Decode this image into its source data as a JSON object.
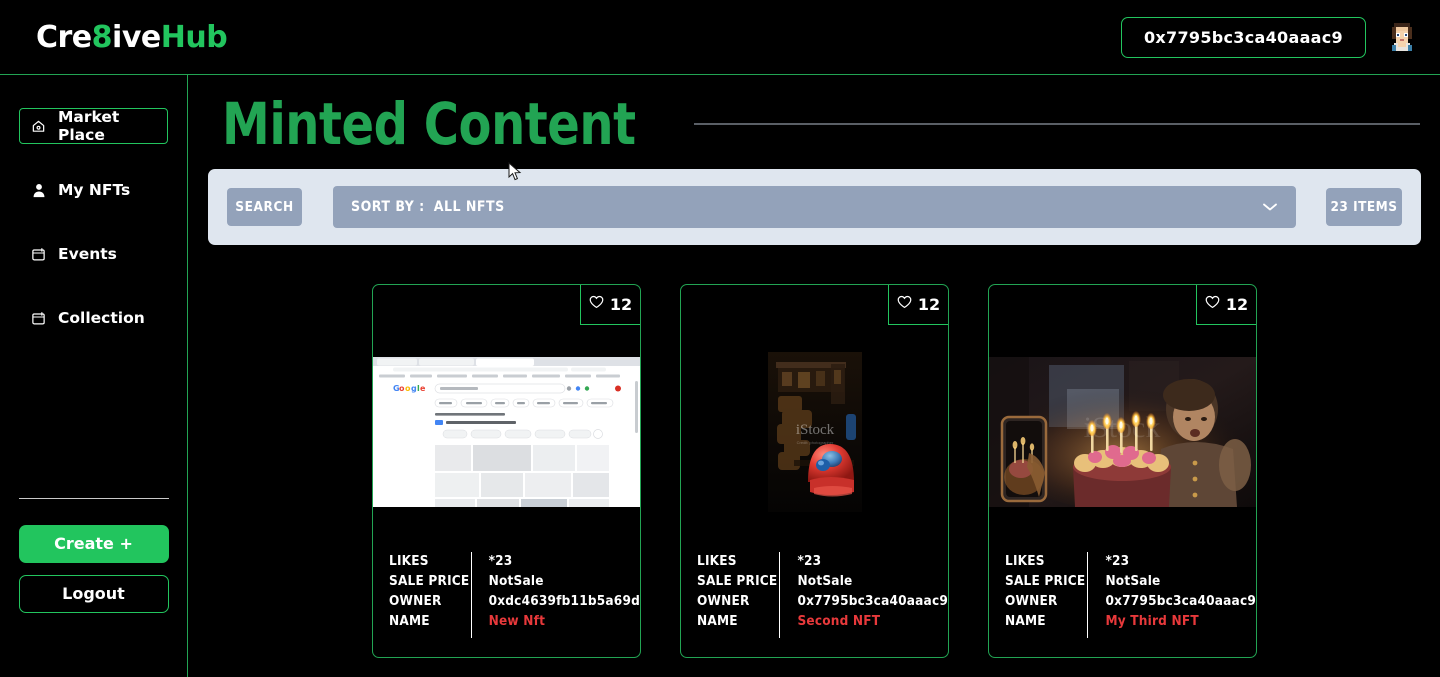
{
  "header": {
    "logo": {
      "part1": "Cre",
      "part2": "8",
      "part3": "ive",
      "part4": "Hub"
    },
    "wallet_address": "0x7795bc3ca40aaac9",
    "avatar_name": "user-avatar"
  },
  "sidebar": {
    "items": [
      {
        "label": "Market Place",
        "icon": "home-icon",
        "active": true
      },
      {
        "label": "My NFTs",
        "icon": "person-icon",
        "active": false
      },
      {
        "label": "Events",
        "icon": "calendar-icon",
        "active": false
      },
      {
        "label": "Collection",
        "icon": "calendar-icon",
        "active": false
      }
    ],
    "create_label": "Create +",
    "logout_label": "Logout"
  },
  "main": {
    "page_title": "Minted Content",
    "toolbar": {
      "search_label": "SEARCH",
      "sort_label": "SORT BY :",
      "sort_value": "ALL NFTS",
      "items_count_label": "23 ITEMS",
      "chevron_icon": "chevron-down-icon"
    },
    "labels": {
      "likes": "LIKES",
      "sale_price": "SALE PRICE",
      "owner": "OWNER",
      "name": "NAME"
    },
    "cards": [
      {
        "likes_badge": "12",
        "likes": "*23",
        "sale_price": "NotSale",
        "owner": "0xdc4639fb11b5a69d",
        "name": "New Nft",
        "media": "browser-screenshot-thumbnail"
      },
      {
        "likes_badge": "12",
        "likes": "*23",
        "sale_price": "NotSale",
        "owner": "0x7795bc3ca40aaac9",
        "name": "Second NFT",
        "media": "carnival-ride-photo"
      },
      {
        "likes_badge": "12",
        "likes": "*23",
        "sale_price": "NotSale",
        "owner": "0x7795bc3ca40aaac9",
        "name": "My Third NFT",
        "media": "birthday-cake-photo"
      }
    ]
  },
  "colors": {
    "brand_green": "#22c55e",
    "border_green": "#22a453",
    "name_red": "#e8393b",
    "toolbar_bg": "#dfe6ef",
    "control_gray": "#93a2ba",
    "background": "#000000"
  }
}
